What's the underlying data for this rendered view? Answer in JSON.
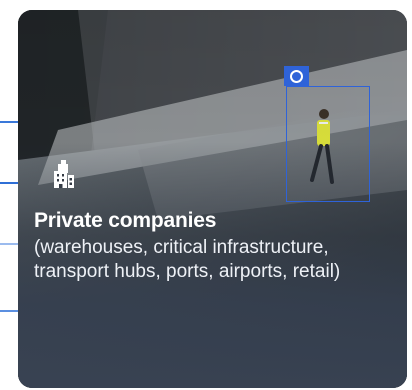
{
  "card": {
    "title": "Private companies",
    "description": "(warehouses, critical infrastructure, transport hubs, ports, airports, retail)",
    "icon": "office-building-icon",
    "detection_icon": "detection-ring-icon"
  },
  "colors": {
    "accent": "#2f63d8",
    "connector": "#2f6fd6",
    "connector_faint": "#8fb3ec",
    "text": "#ffffff"
  }
}
